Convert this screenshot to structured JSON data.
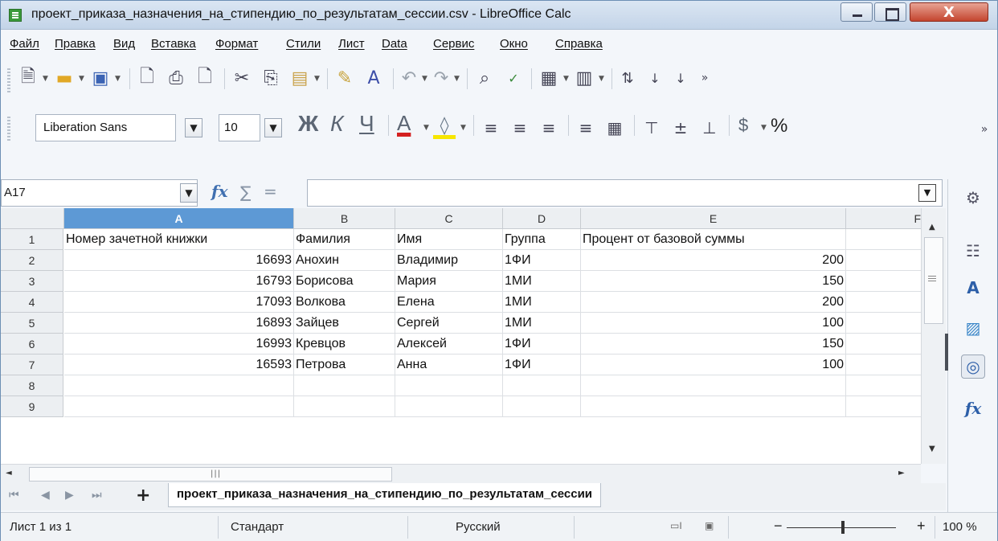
{
  "window": {
    "title": "проект_приказа_назначения_на_стипендию_по_результатам_сессии.csv - LibreOffice Calc",
    "close_label": "X"
  },
  "menu": [
    "Файл",
    "Правка",
    "Вид",
    "Вставка",
    "Формат",
    "Стили",
    "Лист",
    "Data",
    "Сервис",
    "Окно",
    "Справка"
  ],
  "formatting": {
    "font_name": "Liberation Sans",
    "font_size": "10",
    "bold": "Ж",
    "italic": "К",
    "underline": "Ч",
    "font_color": "A",
    "currency": "$",
    "percent": "%"
  },
  "formula_bar": {
    "cell_ref": "A17",
    "fx": "fx",
    "sigma": "∑",
    "equals": "=",
    "value": ""
  },
  "grid": {
    "columns": [
      "A",
      "B",
      "C",
      "D",
      "E",
      "F"
    ],
    "active_column": "A",
    "row_numbers": [
      "1",
      "2",
      "3",
      "4",
      "5",
      "6",
      "7",
      "8",
      "9"
    ],
    "rows": [
      [
        "Номер зачетной книжки",
        "Фамилия",
        "Имя",
        "Группа",
        "Процент от базовой суммы"
      ],
      [
        "16693",
        "Анохин",
        "Владимир",
        "1ФИ",
        "200"
      ],
      [
        "16793",
        "Борисова",
        "Мария",
        "1МИ",
        "150"
      ],
      [
        "17093",
        "Волкова",
        "Елена",
        "1МИ",
        "200"
      ],
      [
        "16893",
        "Зайцев",
        "Сергей",
        "1МИ",
        "100"
      ],
      [
        "16993",
        "Кревцов",
        "Алексей",
        "1ФИ",
        "150"
      ],
      [
        "16593",
        "Петрова",
        "Анна",
        "1ФИ",
        "100"
      ],
      [
        "",
        "",
        "",
        "",
        ""
      ],
      [
        "",
        "",
        "",
        "",
        ""
      ]
    ]
  },
  "sheet_tabs": {
    "add": "+",
    "active_tab": "проект_приказа_назначения_на_стипендию_по_результатам_сессии"
  },
  "status": {
    "sheet": "Лист 1 из 1",
    "style": "Стандарт",
    "language": "Русский",
    "zoom_minus": "−",
    "zoom_plus": "+",
    "zoom": "100 %"
  },
  "sidebar": {
    "icons": [
      "gear-icon",
      "properties-icon",
      "styles-icon",
      "gallery-icon",
      "navigator-icon",
      "functions-icon"
    ],
    "functions_label": "fx"
  },
  "colors": {
    "active_header": "#5d99d5",
    "font_color_bar": "#d42020",
    "highlight_bar": "#f7e600"
  }
}
